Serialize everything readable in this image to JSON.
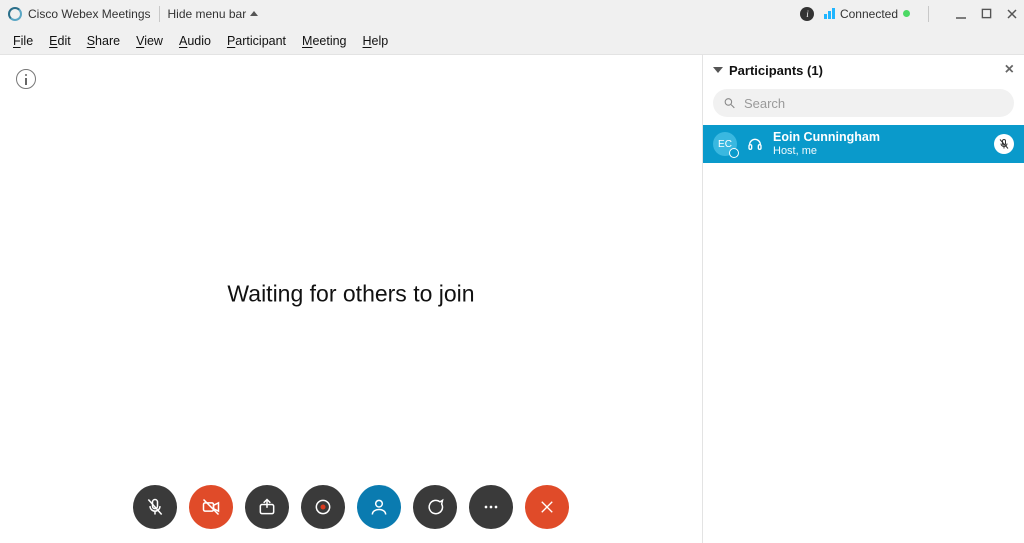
{
  "titlebar": {
    "app_name": "Cisco Webex Meetings",
    "hide_menu_label": "Hide menu bar",
    "connection_label": "Connected"
  },
  "menubar": {
    "items": [
      "File",
      "Edit",
      "Share",
      "View",
      "Audio",
      "Participant",
      "Meeting",
      "Help"
    ]
  },
  "stage": {
    "main_message": "Waiting for others to join"
  },
  "panel": {
    "title": "Participants (1)",
    "search_placeholder": "Search",
    "participant": {
      "avatar_initials": "EC",
      "name": "Eoin  Cunningham",
      "role": "Host, me"
    }
  },
  "colors": {
    "accent_blue": "#0a9acb",
    "accent_red": "#e04b29",
    "dark_grey": "#3a3a3a"
  }
}
